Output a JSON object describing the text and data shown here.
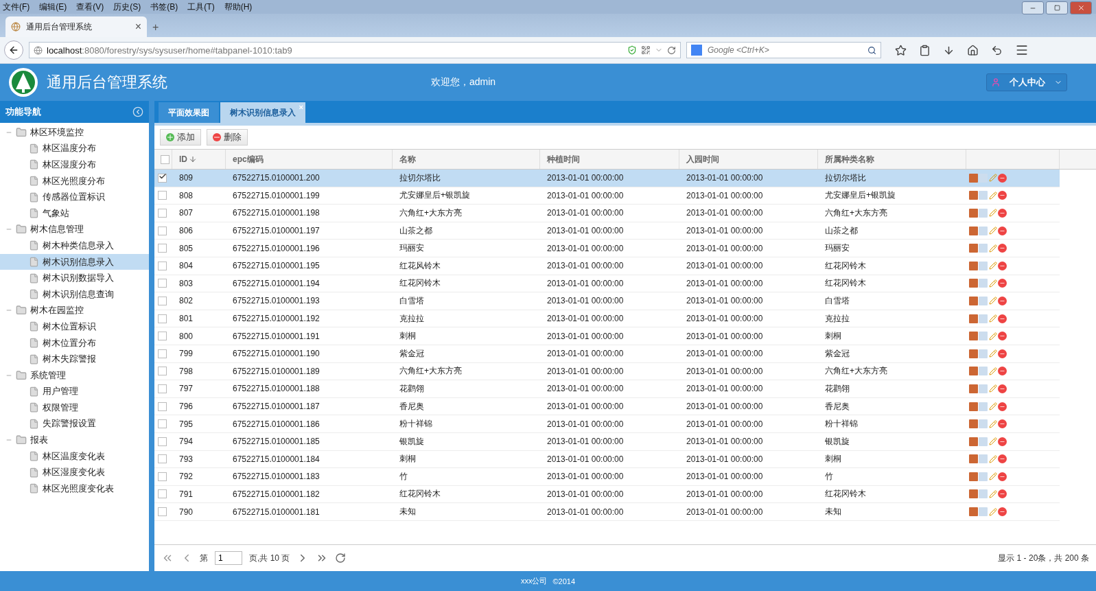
{
  "menu_bar": [
    "文件(F)",
    "编辑(E)",
    "查看(V)",
    "历史(S)",
    "书签(B)",
    "工具(T)",
    "帮助(H)"
  ],
  "browser_tab": {
    "title": "通用后台管理系统",
    "close": "×",
    "new_tab": "+"
  },
  "address": {
    "host": "localhost",
    "path": ":8080/forestry/sys/sysuser/home#tabpanel-1010:tab9"
  },
  "search": {
    "placeholder": "Google <Ctrl+K>"
  },
  "app": {
    "title": "通用后台管理系统",
    "welcome": "欢迎您，admin",
    "user_menu": "个人中心"
  },
  "sidebar": {
    "title": "功能导航",
    "items": [
      {
        "label": "林区环境监控",
        "expanded": true,
        "selected": false,
        "children": [
          {
            "label": "林区温度分布",
            "selected": false
          },
          {
            "label": "林区湿度分布",
            "selected": false
          },
          {
            "label": "林区光照度分布",
            "selected": false
          },
          {
            "label": "传感器位置标识",
            "selected": false
          },
          {
            "label": "气象站",
            "selected": false
          }
        ]
      },
      {
        "label": "树木信息管理",
        "expanded": true,
        "selected": false,
        "children": [
          {
            "label": "树木种类信息录入",
            "selected": false
          },
          {
            "label": "树木识别信息录入",
            "selected": true
          },
          {
            "label": "树木识别数据导入",
            "selected": false
          },
          {
            "label": "树木识别信息查询",
            "selected": false
          }
        ]
      },
      {
        "label": "树木在园监控",
        "expanded": true,
        "selected": false,
        "children": [
          {
            "label": "树木位置标识",
            "selected": false
          },
          {
            "label": "树木位置分布",
            "selected": false
          },
          {
            "label": "树木失踪警报",
            "selected": false
          }
        ]
      },
      {
        "label": "系统管理",
        "expanded": true,
        "selected": false,
        "children": [
          {
            "label": "用户管理",
            "selected": false
          },
          {
            "label": "权限管理",
            "selected": false
          },
          {
            "label": "失踪警报设置",
            "selected": false
          }
        ]
      },
      {
        "label": "报表",
        "expanded": true,
        "selected": false,
        "children": [
          {
            "label": "林区温度变化表",
            "selected": false
          },
          {
            "label": "林区湿度变化表",
            "selected": false
          },
          {
            "label": "林区光照度变化表",
            "selected": false
          }
        ]
      }
    ]
  },
  "content_tabs": [
    {
      "label": "平面效果图",
      "selected": false
    },
    {
      "label": "树木识别信息录入",
      "selected": true,
      "close": "×"
    }
  ],
  "toolbar": [
    {
      "label": "添加",
      "kind": "add"
    },
    {
      "label": "删除",
      "kind": "delete"
    }
  ],
  "table": {
    "columns": [
      "ID",
      "epc编码",
      "名称",
      "种植时间",
      "入园时间",
      "所属种类名称"
    ],
    "all_checked": false,
    "rows": [
      {
        "selected": true,
        "cells": [
          "809",
          "67522715.0100001.200",
          "拉切尔塔比",
          "2013-01-01 00:00:00",
          "2013-01-01 00:00:00",
          "拉切尔塔比"
        ]
      },
      {
        "selected": false,
        "cells": [
          "808",
          "67522715.0100001.199",
          "尤安娜皇后+银凯旋",
          "2013-01-01 00:00:00",
          "2013-01-01 00:00:00",
          "尤安娜皇后+银凯旋"
        ]
      },
      {
        "selected": false,
        "cells": [
          "807",
          "67522715.0100001.198",
          "六角红+大东方亮",
          "2013-01-01 00:00:00",
          "2013-01-01 00:00:00",
          "六角红+大东方亮"
        ]
      },
      {
        "selected": false,
        "cells": [
          "806",
          "67522715.0100001.197",
          "山茶之都",
          "2013-01-01 00:00:00",
          "2013-01-01 00:00:00",
          "山茶之都"
        ]
      },
      {
        "selected": false,
        "cells": [
          "805",
          "67522715.0100001.196",
          "玛丽安",
          "2013-01-01 00:00:00",
          "2013-01-01 00:00:00",
          "玛丽安"
        ]
      },
      {
        "selected": false,
        "cells": [
          "804",
          "67522715.0100001.195",
          "红花风铃木",
          "2013-01-01 00:00:00",
          "2013-01-01 00:00:00",
          "红花冈铃木"
        ]
      },
      {
        "selected": false,
        "cells": [
          "803",
          "67522715.0100001.194",
          "红花冈铃木",
          "2013-01-01 00:00:00",
          "2013-01-01 00:00:00",
          "红花冈铃木"
        ]
      },
      {
        "selected": false,
        "cells": [
          "802",
          "67522715.0100001.193",
          "白雪塔",
          "2013-01-01 00:00:00",
          "2013-01-01 00:00:00",
          "白雪塔"
        ]
      },
      {
        "selected": false,
        "cells": [
          "801",
          "67522715.0100001.192",
          "克拉拉",
          "2013-01-01 00:00:00",
          "2013-01-01 00:00:00",
          "克拉拉"
        ]
      },
      {
        "selected": false,
        "cells": [
          "800",
          "67522715.0100001.191",
          "刺桐",
          "2013-01-01 00:00:00",
          "2013-01-01 00:00:00",
          "刺桐"
        ]
      },
      {
        "selected": false,
        "cells": [
          "799",
          "67522715.0100001.190",
          "紫金冠",
          "2013-01-01 00:00:00",
          "2013-01-01 00:00:00",
          "紫金冠"
        ]
      },
      {
        "selected": false,
        "cells": [
          "798",
          "67522715.0100001.189",
          "六角红+大东方亮",
          "2013-01-01 00:00:00",
          "2013-01-01 00:00:00",
          "六角红+大东方亮"
        ]
      },
      {
        "selected": false,
        "cells": [
          "797",
          "67522715.0100001.188",
          "花鹳翎",
          "2013-01-01 00:00:00",
          "2013-01-01 00:00:00",
          "花鹳翎"
        ]
      },
      {
        "selected": false,
        "cells": [
          "796",
          "67522715.0100001.187",
          "香尼奥",
          "2013-01-01 00:00:00",
          "2013-01-01 00:00:00",
          "香尼奥"
        ]
      },
      {
        "selected": false,
        "cells": [
          "795",
          "67522715.0100001.186",
          "粉十祥锦",
          "2013-01-01 00:00:00",
          "2013-01-01 00:00:00",
          "粉十祥锦"
        ]
      },
      {
        "selected": false,
        "cells": [
          "794",
          "67522715.0100001.185",
          "银凯旋",
          "2013-01-01 00:00:00",
          "2013-01-01 00:00:00",
          "银凯旋"
        ]
      },
      {
        "selected": false,
        "cells": [
          "793",
          "67522715.0100001.184",
          "刺桐",
          "2013-01-01 00:00:00",
          "2013-01-01 00:00:00",
          "刺桐"
        ]
      },
      {
        "selected": false,
        "cells": [
          "792",
          "67522715.0100001.183",
          "竹",
          "2013-01-01 00:00:00",
          "2013-01-01 00:00:00",
          "竹"
        ]
      },
      {
        "selected": false,
        "cells": [
          "791",
          "67522715.0100001.182",
          "红花冈铃木",
          "2013-01-01 00:00:00",
          "2013-01-01 00:00:00",
          "红花冈铃木"
        ]
      },
      {
        "selected": false,
        "cells": [
          "790",
          "67522715.0100001.181",
          "未知",
          "2013-01-01 00:00:00",
          "2013-01-01 00:00:00",
          "未知"
        ]
      }
    ]
  },
  "pager": {
    "page_prefix": "第",
    "page": "1",
    "page_suffix": "页,共 10 页",
    "summary": "显示 1 - 20条，共 200 条"
  },
  "footer": {
    "company": "xxx公司",
    "copyright": "©2014"
  }
}
